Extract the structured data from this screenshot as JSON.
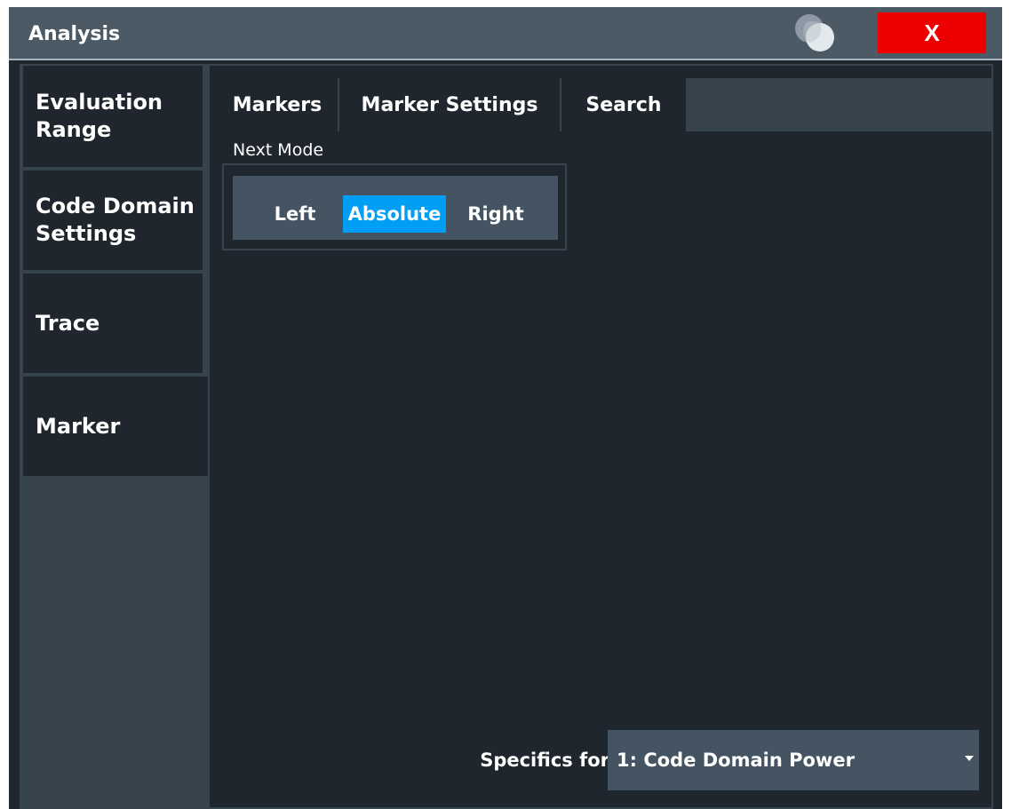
{
  "window": {
    "title": "Analysis",
    "close_label": "X",
    "logo_icon": "overlapping-circles-logo",
    "close_icon": "close-x-icon"
  },
  "sidebar": {
    "items": [
      {
        "label": "Evaluation\nRange",
        "active": false
      },
      {
        "label": "Code Domain\nSettings",
        "active": false
      },
      {
        "label": "Trace",
        "active": false
      },
      {
        "label": "Marker",
        "active": true
      }
    ]
  },
  "tabs": [
    {
      "label": "Markers",
      "active": false
    },
    {
      "label": "Marker Settings",
      "active": false
    },
    {
      "label": "Search",
      "active": true
    }
  ],
  "next_mode": {
    "label": "Next Mode",
    "options": [
      "Left",
      "Absolute",
      "Right"
    ],
    "selected": "Absolute"
  },
  "specifics": {
    "label": "Specifics for",
    "value": "1: Code Domain Power",
    "arrow_icon": "dropdown-arrow-icon"
  },
  "colors": {
    "title_bar": "#4c5a66",
    "panel": "#1f262e",
    "frame": "#37434d",
    "accent": "#009ff5",
    "close": "#ee0000"
  }
}
